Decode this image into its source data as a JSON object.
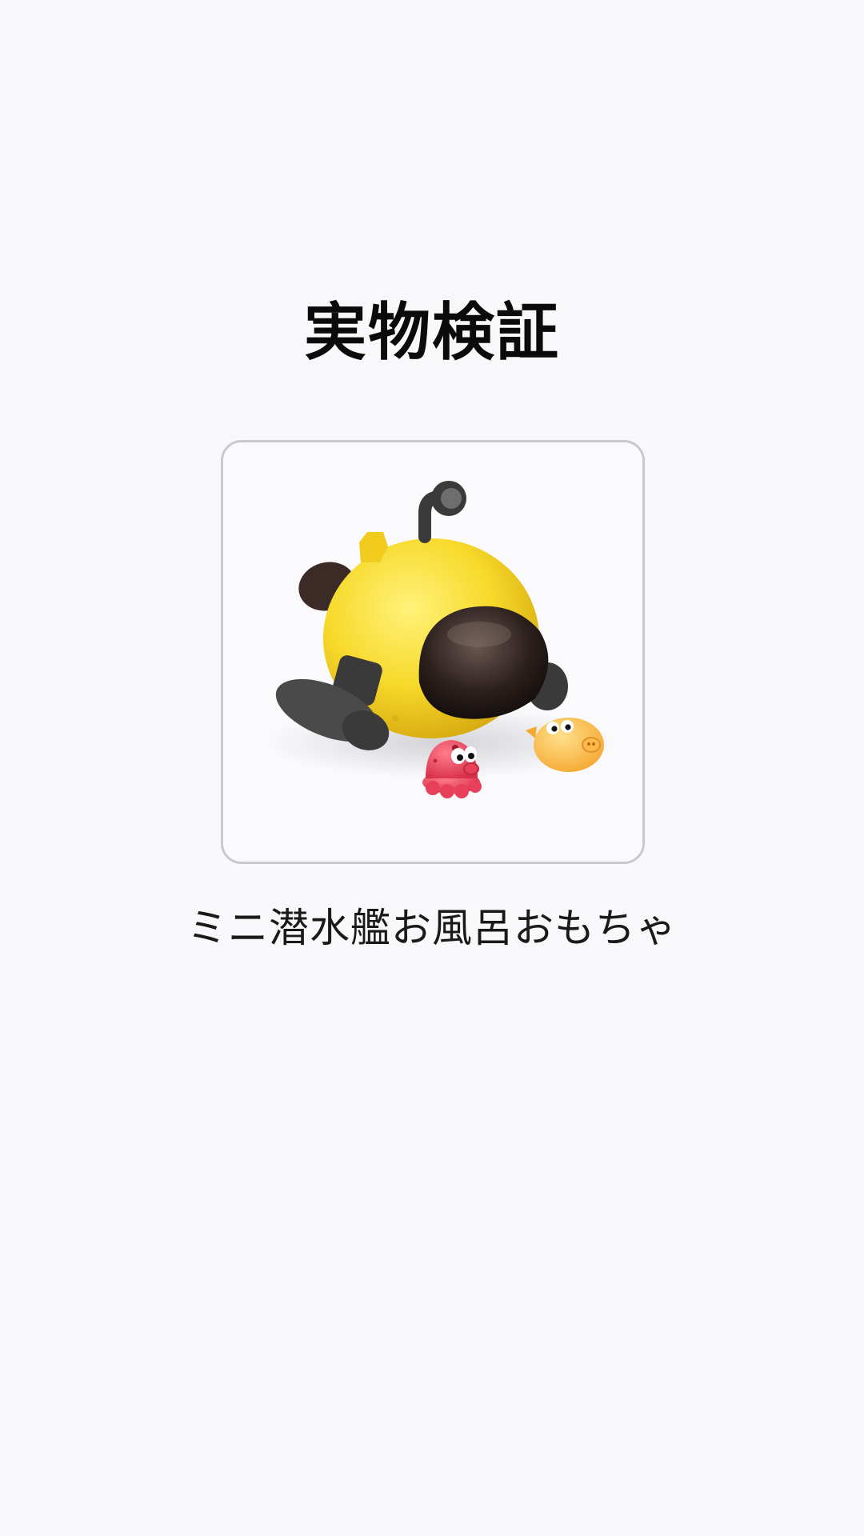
{
  "page": {
    "title": "実物検証",
    "background_color": "#f8f8fb"
  },
  "product": {
    "name": "ミニ潜水艦お風呂おもちゃ",
    "image": {
      "icon": "submarine-toy-photo",
      "colors": {
        "body": "#f7d92a",
        "window": "#2a1f1c",
        "fins": "#4a4a4a",
        "octopus": "#e8405a",
        "pufferfish": "#ffc24d"
      }
    }
  }
}
